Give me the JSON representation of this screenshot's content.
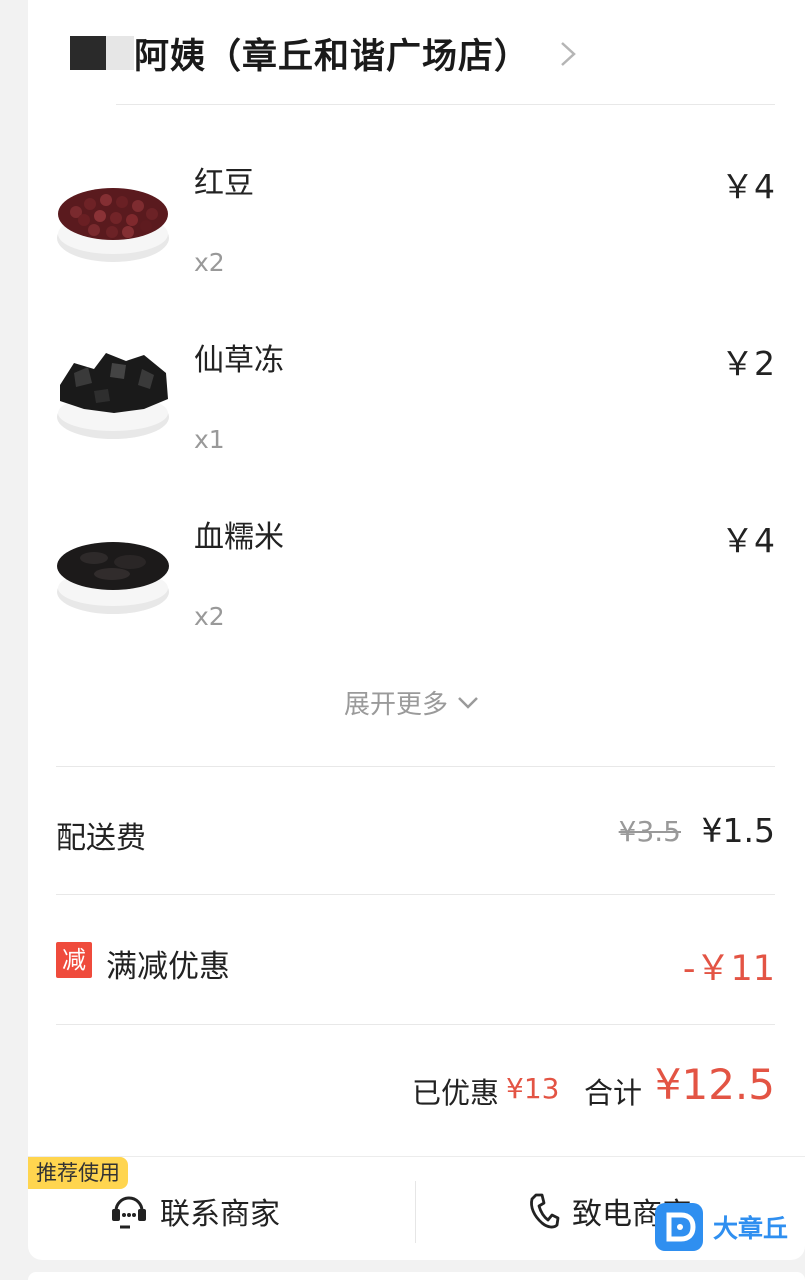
{
  "shop": {
    "name": "阿姨（章丘和谐广场店）"
  },
  "items": [
    {
      "name": "红豆",
      "qty": "x2",
      "price": "￥4"
    },
    {
      "name": "仙草冻",
      "qty": "x1",
      "price": "￥2"
    },
    {
      "name": "血糯米",
      "qty": "x2",
      "price": "￥4"
    }
  ],
  "expand": {
    "label": "展开更多"
  },
  "delivery": {
    "label": "配送费",
    "original": "¥3.5",
    "current": "¥1.5"
  },
  "discount": {
    "badge": "减",
    "label": "满减优惠",
    "amount": "-￥11"
  },
  "summary": {
    "saved_label": "已优惠",
    "saved_amount": "¥13",
    "total_label": "合计",
    "total_amount": "¥12.5"
  },
  "actions": {
    "recommend_tag": "推荐使用",
    "contact_label": "联系商家",
    "call_label": "致电商家"
  },
  "watermark": {
    "text": "大章丘"
  },
  "colors": {
    "accent_red": "#e35444",
    "badge_red": "#ef4b3c",
    "recommend_yellow": "#ffd54f",
    "watermark_blue": "#2f8ff0"
  }
}
